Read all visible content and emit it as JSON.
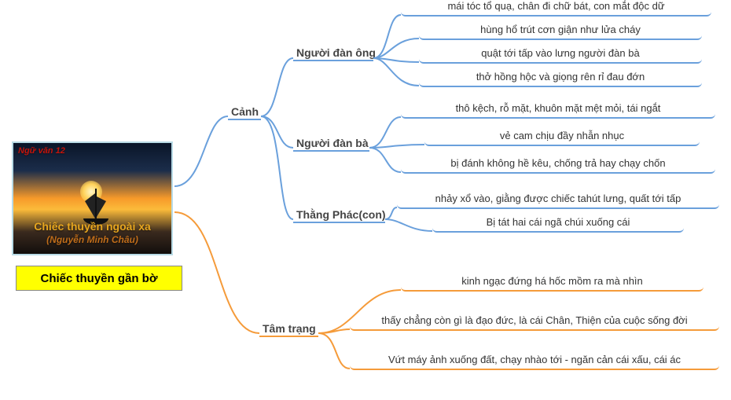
{
  "root": {
    "category": "Ngữ văn 12",
    "title": "Chiếc thuyền ngoài xa",
    "author": "(Nguyễn Minh Châu)",
    "main_topic": "Chiếc thuyền gần bờ"
  },
  "branch1": {
    "label": "Cảnh",
    "sub1": {
      "label": "Người đàn ông",
      "leaves": [
        "mái tóc tổ quạ, chân đi chữ bát, con mắt độc dữ",
        "hùng hổ trút cơn giận như lửa cháy",
        "quật tới tấp vào lưng người đàn bà",
        "thở hồng hộc và giọng rên rỉ đau đớn"
      ]
    },
    "sub2": {
      "label": "Người đàn bà",
      "leaves": [
        "thô kệch, rỗ mặt, khuôn mặt mệt mỏi, tái ngắt",
        "vẻ cam chịu đầy nhẫn nhục",
        "bị đánh không hề kêu, chống trả hay chạy chốn"
      ]
    },
    "sub3": {
      "label": "Thằng Phác(con)",
      "leaves": [
        "nhảy xổ vào, giằng được chiếc tahút lưng, quất tới tấp",
        "Bị tát hai cái ngã chúi xuống cái"
      ]
    }
  },
  "branch2": {
    "label": "Tâm trạng",
    "leaves": [
      "kinh ngạc đứng há hốc mồm ra mà nhìn",
      "thấy chẳng còn gì là đạo đức, là cái Chân, Thiện của cuộc sống đời",
      "Vứt máy ảnh xuống đất, chạy nhào tới - ngăn cản cái xấu, cái ác"
    ]
  }
}
